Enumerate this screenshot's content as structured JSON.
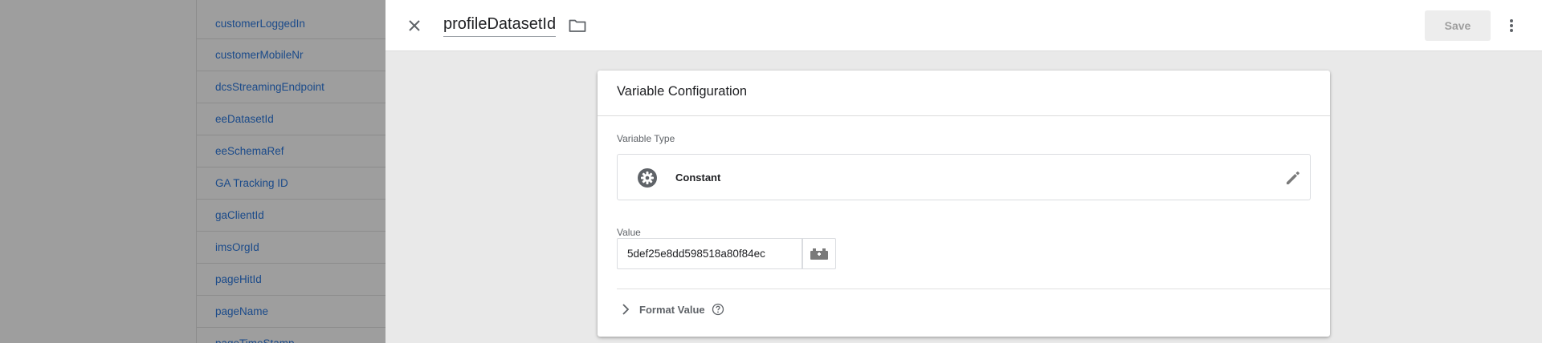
{
  "background_list": {
    "items": [
      "customerLoggedIn",
      "customerMobileNr",
      "dcsStreamingEndpoint",
      "eeDatasetId",
      "eeSchemaRef",
      "GA Tracking ID",
      "gaClientId",
      "imsOrgId",
      "pageHitId",
      "pageName",
      "pageTimeStamp"
    ]
  },
  "header": {
    "title": "profileDatasetId",
    "save_label": "Save",
    "close_icon": "close-icon",
    "folder_icon": "folder-icon",
    "more_icon": "more-vert-icon"
  },
  "card": {
    "title": "Variable Configuration",
    "variable_type_label": "Variable Type",
    "variable_type_value": "Constant",
    "value_label": "Value",
    "value": "5def25e8dd598518a80f84ec",
    "format_value_label": "Format Value"
  },
  "colors": {
    "link": "#1a4a8a",
    "overlay": "#9e9e9e",
    "panel_bg": "#e9e9e9",
    "icon_gray": "#5f6368"
  }
}
